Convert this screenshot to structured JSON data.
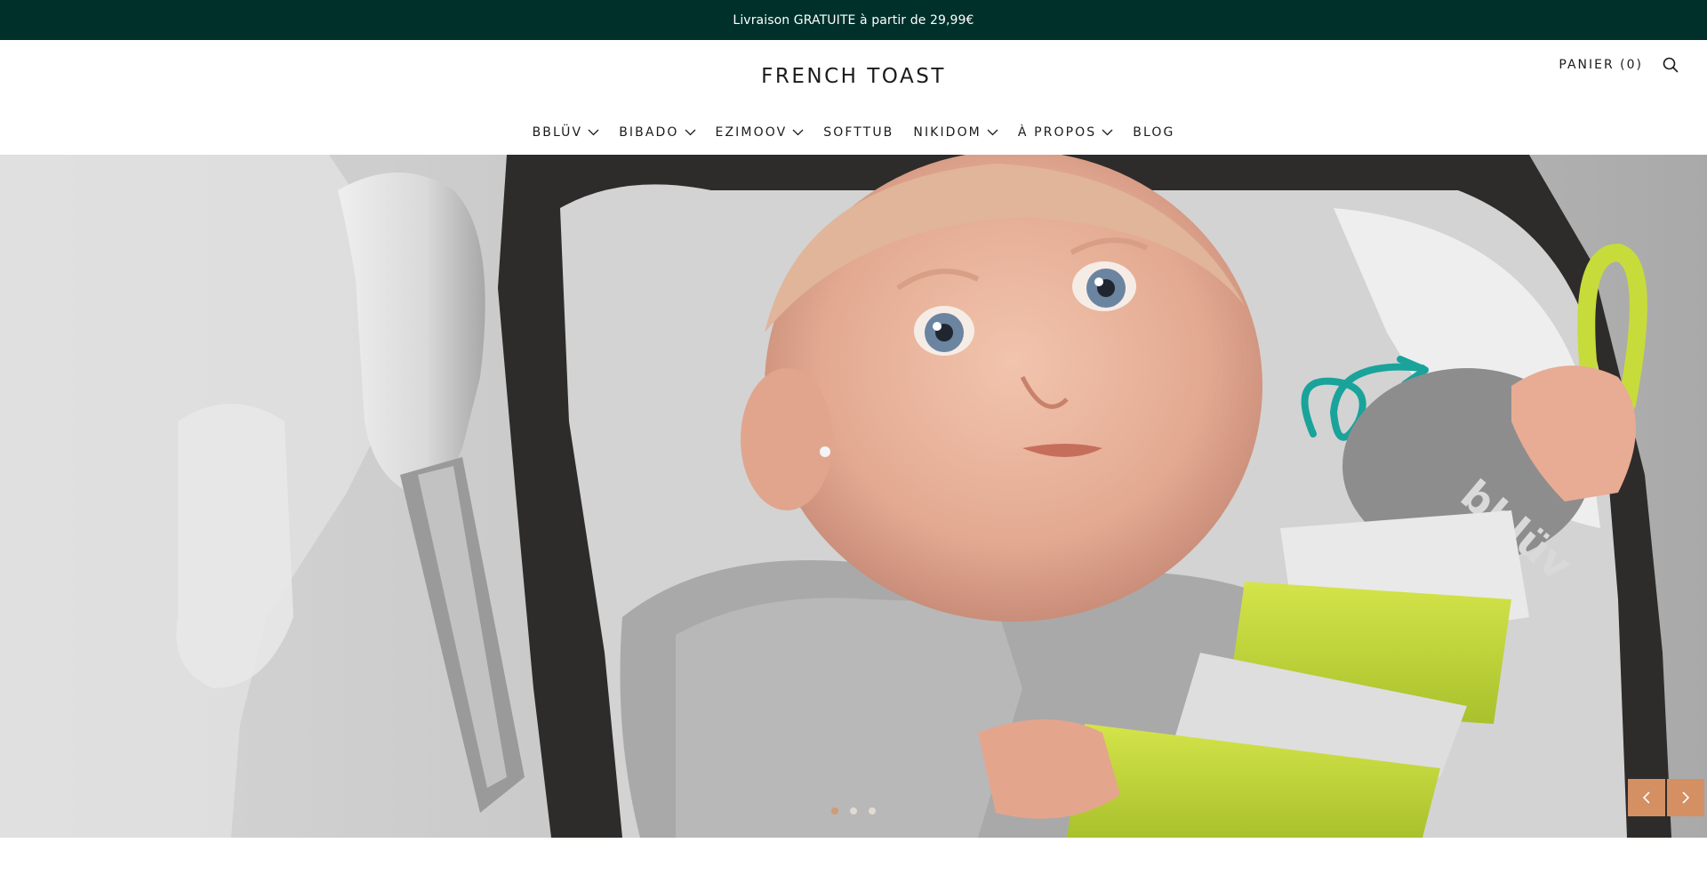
{
  "announcement": {
    "text": "Livraison GRATUITE à partir de 29,99€"
  },
  "header": {
    "logo": "FRENCH TOAST",
    "cart_label": "PANIER (0)",
    "search_icon": "search-icon"
  },
  "nav": {
    "items": [
      {
        "label": "BBLÜV",
        "has_dropdown": true
      },
      {
        "label": "BIBADO",
        "has_dropdown": true
      },
      {
        "label": "EZIMOOV",
        "has_dropdown": true
      },
      {
        "label": "SOFTTUB",
        "has_dropdown": false
      },
      {
        "label": "NIKIDOM",
        "has_dropdown": true
      },
      {
        "label": "À PROPOS",
        "has_dropdown": true
      },
      {
        "label": "BLOG",
        "has_dropdown": false
      }
    ]
  },
  "hero": {
    "image": "baby-with-bbluv-formula-dispenser",
    "logo_on_product": "bblüv",
    "slides_count": 3,
    "active_slide": 1,
    "controls": {
      "prev_icon": "chevron-left-icon",
      "next_icon": "chevron-right-icon"
    }
  },
  "colors": {
    "announcement_bg": "#00302a",
    "accent": "#d48f63",
    "teal_arrow": "#1aa39a",
    "product_lime": "#c7dc3a"
  }
}
